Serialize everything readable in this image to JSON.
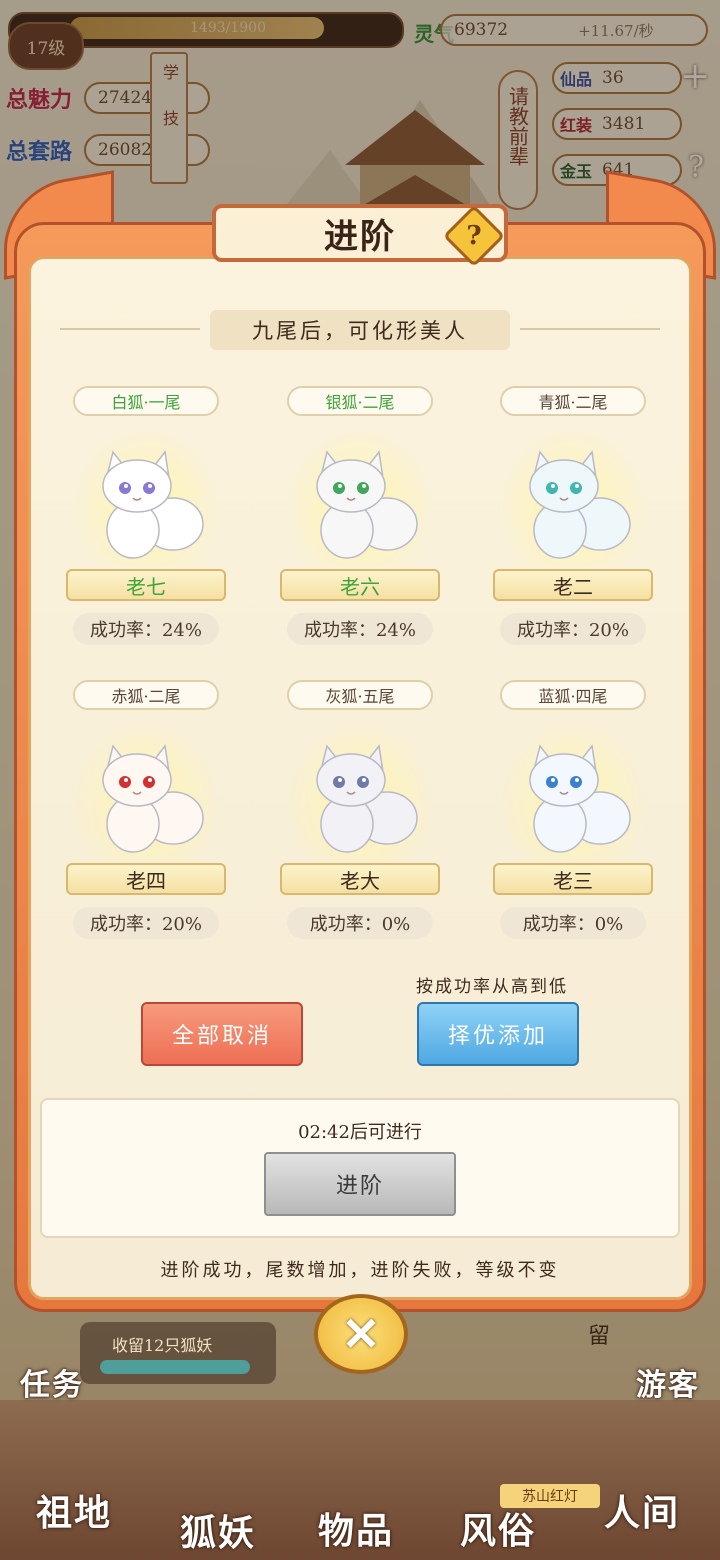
{
  "hud": {
    "level": "17级",
    "exp": "1493/1900",
    "qi_label": "灵气",
    "qi_value": "69372",
    "qi_rate": "+11.67/秒",
    "charm_label": "总魅力",
    "charm_value": "27424",
    "skill_label": "总套路",
    "skill_value": "26082",
    "side_1": "学",
    "side_2": "技",
    "ask_mentor": "请教前辈",
    "res1_label": "仙品",
    "res1_value": "36",
    "res2_label": "红装",
    "res2_value": "3481",
    "res3_label": "金玉",
    "res3_value": "641"
  },
  "modal": {
    "title": "进阶",
    "subtitle": "九尾后，可化形美人",
    "foxes": [
      {
        "tag": "白狐·一尾",
        "name": "老七",
        "rate": "成功率：24%",
        "green": true,
        "eye": "#8a7ad6",
        "body": "#ffffff"
      },
      {
        "tag": "银狐·二尾",
        "name": "老六",
        "rate": "成功率：24%",
        "green": true,
        "eye": "#3fa85a",
        "body": "#f7f7f7"
      },
      {
        "tag": "青狐·二尾",
        "name": "老二",
        "rate": "成功率：20%",
        "green": false,
        "eye": "#3fb6b0",
        "body": "#eef8fa"
      },
      {
        "tag": "赤狐·二尾",
        "name": "老四",
        "rate": "成功率：20%",
        "green": false,
        "eye": "#d0302f",
        "body": "#fff8f2"
      },
      {
        "tag": "灰狐·五尾",
        "name": "老大",
        "rate": "成功率：0%",
        "green": false,
        "eye": "#6f7aa8",
        "body": "#f1f1f6"
      },
      {
        "tag": "蓝狐·四尾",
        "name": "老三",
        "rate": "成功率：0%",
        "green": false,
        "eye": "#3b7fd0",
        "body": "#f3f8ff"
      }
    ],
    "cancel_all": "全部取消",
    "sort_hint": "按成功率从高到低",
    "auto_add": "择优添加",
    "timer": "02:42后可进行",
    "advance_button": "进阶",
    "footer": "进阶成功，尾数增加，进阶失败，等级不变"
  },
  "bottom": {
    "task": "任务",
    "collect": "收留12只狐妖",
    "stay": "留",
    "right_label": "游客",
    "nav": [
      "祖地",
      "狐妖",
      "物品",
      "风俗",
      "人间"
    ],
    "shop_tag": "苏山红灯"
  }
}
